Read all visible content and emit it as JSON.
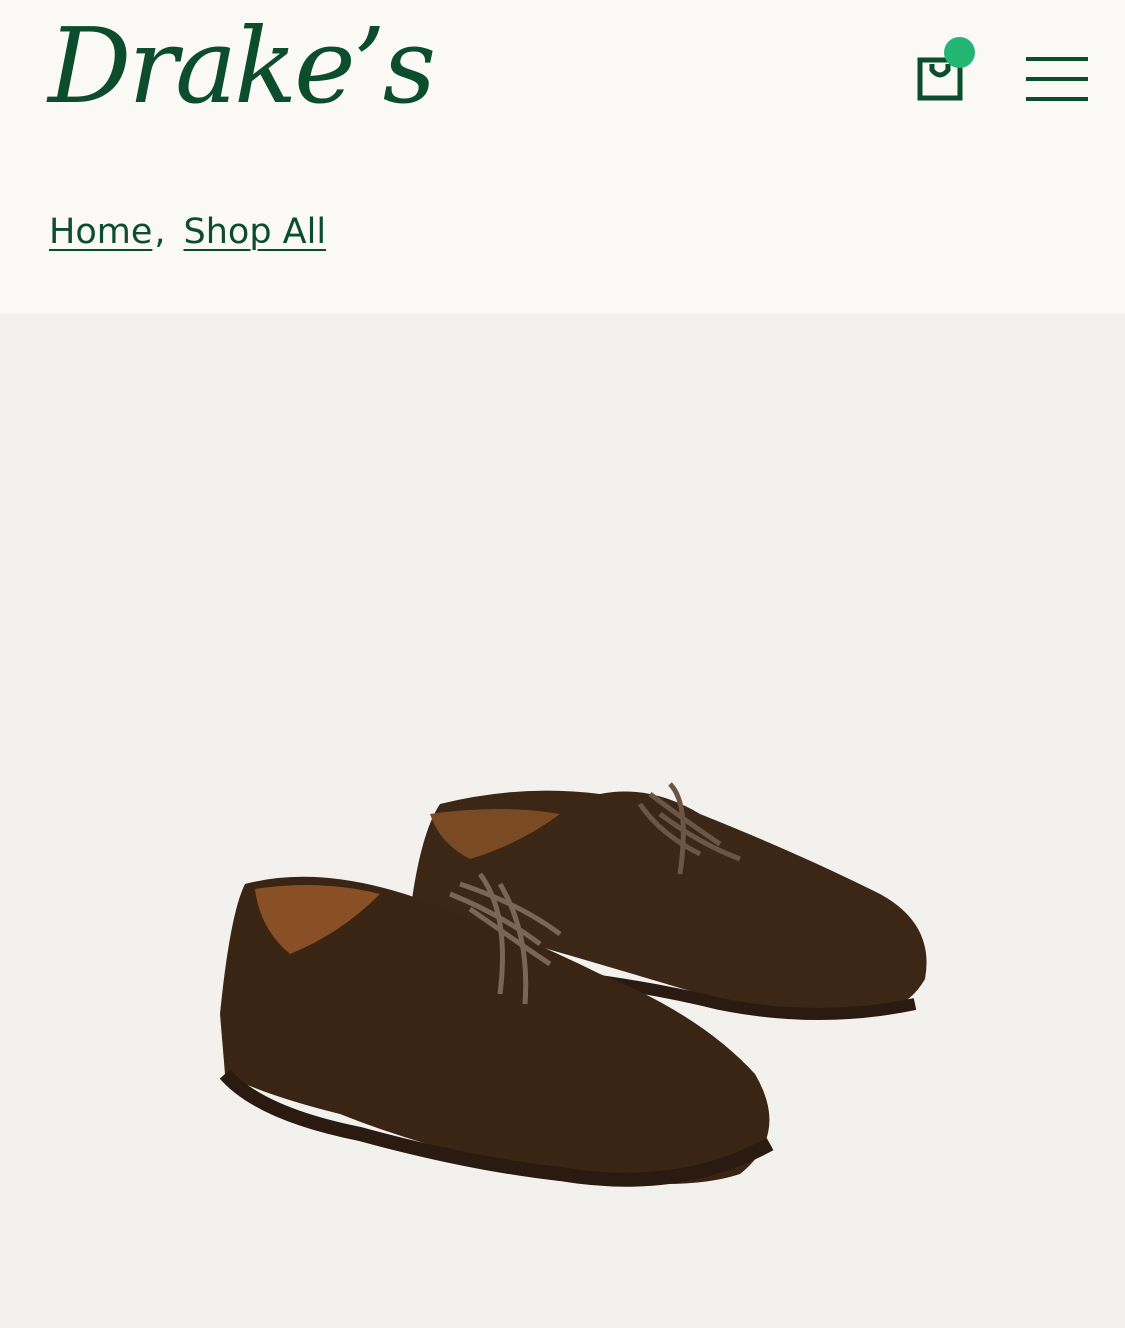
{
  "header": {
    "logo_text": "Drake’s",
    "cart_icon": "shopping-bag-icon",
    "menu_icon": "hamburger-menu-icon",
    "accent_color": "#0b4d2c",
    "badge_color": "#22b573"
  },
  "breadcrumb": {
    "items": [
      "Home",
      "Shop All"
    ],
    "separator": ","
  },
  "product_image": {
    "subject": "shoe-pair-image",
    "background_color": "#f2f1ee"
  }
}
